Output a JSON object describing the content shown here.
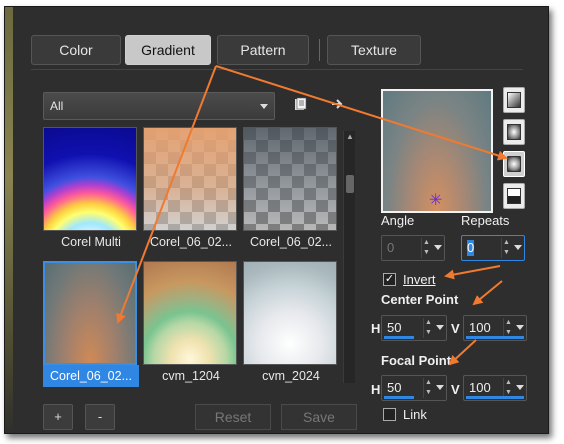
{
  "tabs": [
    {
      "label": "Color",
      "active": false
    },
    {
      "label": "Gradient",
      "active": true
    },
    {
      "label": "Pattern",
      "active": false
    },
    {
      "label": "Texture",
      "active": false
    }
  ],
  "category_dropdown": {
    "selected": "All"
  },
  "icons": {
    "library": "library-icon",
    "arrow": "arrow-right-icon"
  },
  "gradients": [
    {
      "name": "Corel Multi"
    },
    {
      "name": "Corel_06_02..."
    },
    {
      "name": "Corel_06_02..."
    },
    {
      "name": "Corel_06_02...",
      "selected": true
    },
    {
      "name": "cvm_1204"
    },
    {
      "name": "cvm_2024"
    }
  ],
  "buttons": {
    "add": "+",
    "remove": "-",
    "reset": "Reset",
    "save": "Save"
  },
  "properties": {
    "angle": {
      "label": "Angle",
      "value": "0"
    },
    "repeats": {
      "label": "Repeats",
      "value": "0"
    },
    "invert": {
      "label": "Invert",
      "checked": true
    },
    "center_point": {
      "label": "Center Point",
      "h_label": "H",
      "h": "50",
      "v_label": "V",
      "v": "100"
    },
    "focal_point": {
      "label": "Focal Point",
      "h_label": "H",
      "h": "50",
      "v_label": "V",
      "v": "100"
    },
    "link": {
      "label": "Link",
      "checked": false
    }
  },
  "colors": {
    "accent": "#2f86e3",
    "annotation_arrow": "#f07a30",
    "panel": "#2e2e2e"
  }
}
